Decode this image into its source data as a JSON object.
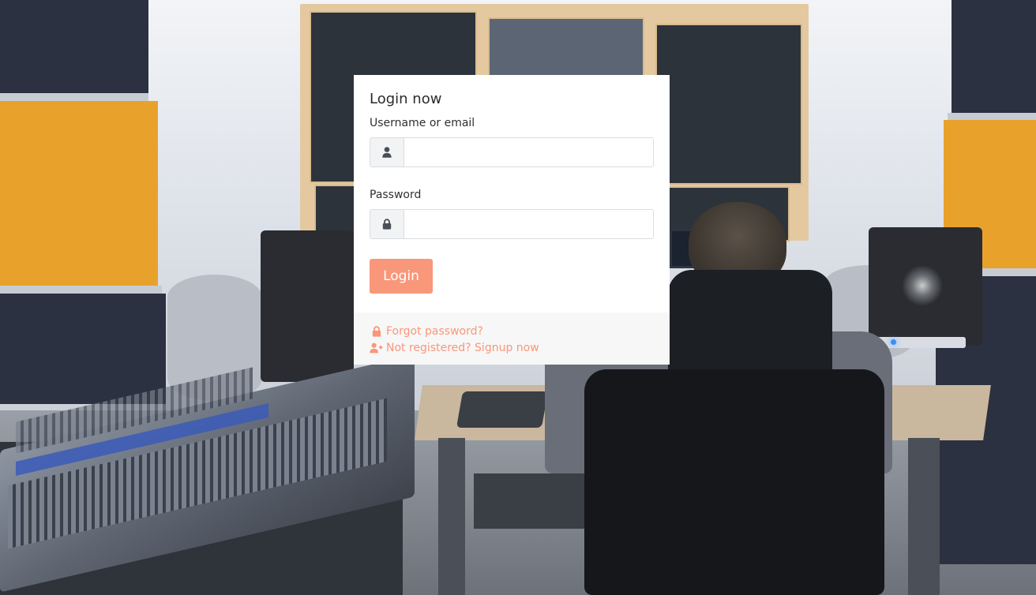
{
  "login": {
    "title": "Login now",
    "username_label": "Username or email",
    "username_value": "",
    "password_label": "Password",
    "password_value": "",
    "submit_label": "Login"
  },
  "footer": {
    "forgot_label": "Forgot password?",
    "signup_label": "Not registered? Signup now"
  },
  "icons": {
    "username": "user-icon",
    "password": "lock-icon",
    "forgot": "lock-icon",
    "signup": "user-plus-icon"
  },
  "colors": {
    "accent": "#f9977a",
    "card_bg": "#ffffff",
    "footer_bg": "#f7f7f7",
    "addon_bg": "#f2f3f5"
  }
}
